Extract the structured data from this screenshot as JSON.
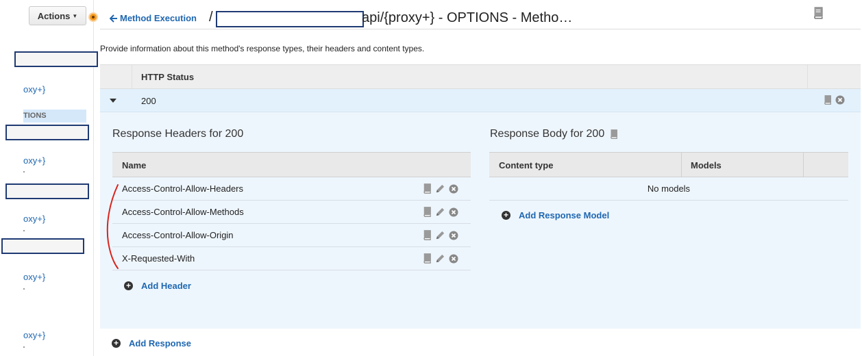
{
  "sidebar": {
    "actions_label": "Actions",
    "items": [
      {
        "label": "oxy+}"
      },
      {
        "label": "oxy+}"
      },
      {
        "label": "oxy+}"
      },
      {
        "label": "oxy+}"
      },
      {
        "label": "oxy+}"
      }
    ],
    "selected_method": "TIONS"
  },
  "header": {
    "back_label": "Method Execution",
    "path_prefix": "/",
    "path_suffix": "api/{proxy+} - OPTIONS - Metho…"
  },
  "description": "Provide information about this method's response types, their headers and content types.",
  "status_table": {
    "column": "HTTP Status",
    "rows": [
      {
        "status": "200"
      }
    ]
  },
  "response_headers": {
    "title": "Response Headers for 200",
    "column": "Name",
    "items": [
      "Access-Control-Allow-Headers",
      "Access-Control-Allow-Methods",
      "Access-Control-Allow-Origin",
      "X-Requested-With"
    ],
    "add_label": "Add Header"
  },
  "response_body": {
    "title": "Response Body for 200",
    "columns": [
      "Content type",
      "Models"
    ],
    "empty_text": "No models",
    "add_label": "Add Response Model"
  },
  "add_response_label": "Add Response",
  "colors": {
    "link": "#1f67b1",
    "panel": "#eef6fd",
    "status_row": "#e3f1fc",
    "redaction_border": "#1f3a73",
    "annotation": "#d9231d"
  }
}
